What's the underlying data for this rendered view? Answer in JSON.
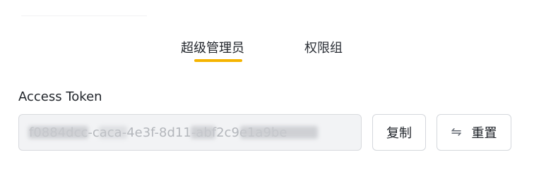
{
  "tabs": [
    {
      "label": "超级管理员",
      "active": true
    },
    {
      "label": "权限组",
      "active": false
    }
  ],
  "colors": {
    "accent": "#f5b400",
    "input_bg": "#f2f3f5",
    "border": "#d4d7dc"
  },
  "token": {
    "label": "Access Token",
    "value": "f0884dcc-caca-4e3f-8d11-abf2c9e1a9be",
    "value_visible": "-caca-4e3f-",
    "redacted": true
  },
  "actions": {
    "copy_label": "复制",
    "reset_label": "重置",
    "reset_icon": "swap-arrows-icon"
  }
}
